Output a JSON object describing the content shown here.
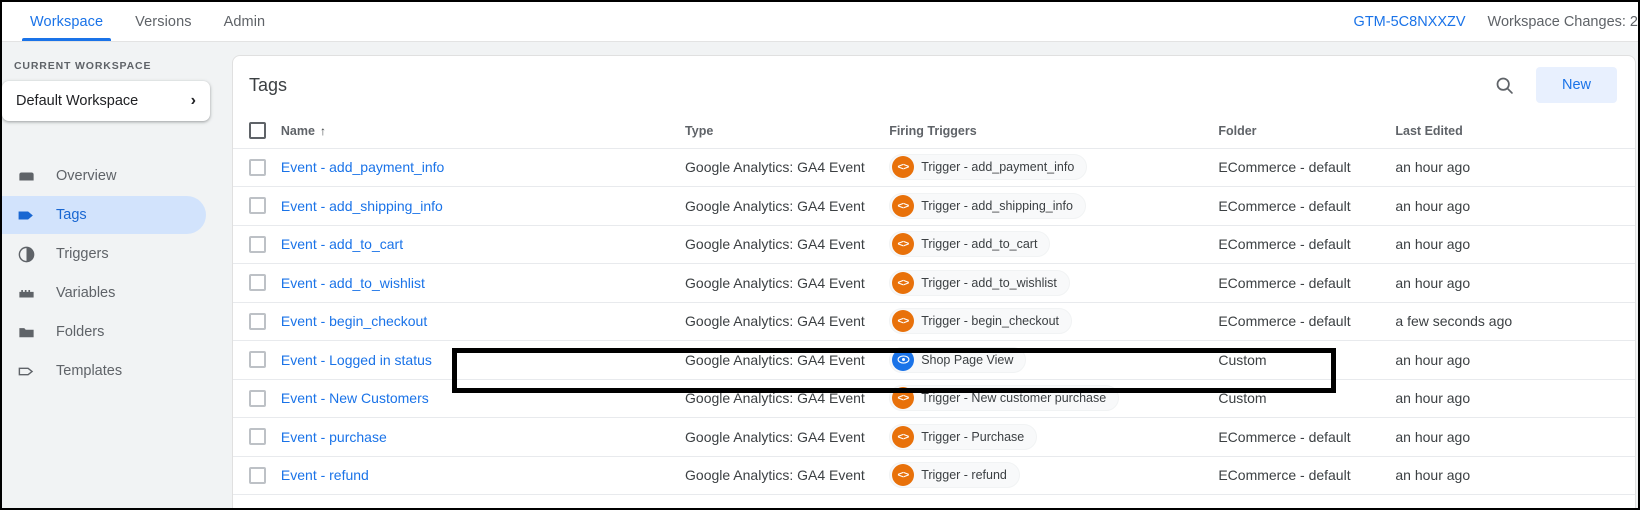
{
  "topnav": {
    "tabs": [
      {
        "label": "Workspace",
        "active": true
      },
      {
        "label": "Versions",
        "active": false
      },
      {
        "label": "Admin",
        "active": false
      }
    ],
    "container_id": "GTM-5C8NXXZV",
    "workspace_changes": "Workspace Changes: 2"
  },
  "sidebar": {
    "section_label": "CURRENT WORKSPACE",
    "workspace_name": "Default Workspace",
    "chevron": "›",
    "items": [
      {
        "label": "Overview",
        "icon": "overview-icon",
        "selected": false
      },
      {
        "label": "Tags",
        "icon": "tag-icon",
        "selected": true
      },
      {
        "label": "Triggers",
        "icon": "trigger-icon",
        "selected": false
      },
      {
        "label": "Variables",
        "icon": "variable-icon",
        "selected": false
      },
      {
        "label": "Folders",
        "icon": "folder-icon",
        "selected": false
      },
      {
        "label": "Templates",
        "icon": "template-icon",
        "selected": false
      }
    ]
  },
  "card": {
    "title": "Tags",
    "search_icon": "search-icon",
    "new_label": "New"
  },
  "table": {
    "columns": [
      "Name",
      "Type",
      "Firing Triggers",
      "Folder",
      "Last Edited"
    ],
    "sort_column": "Name",
    "sort_arrow": "↑",
    "rows": [
      {
        "name": "Event - add_payment_info",
        "type": "Google Analytics: GA4 Event",
        "trigger": "Trigger - add_payment_info",
        "trigger_icon": "code-trigger-icon",
        "trigger_icon_color": "#e8710a",
        "folder": "ECommerce - default",
        "last_edited": "an hour ago",
        "highlighted": false
      },
      {
        "name": "Event - add_shipping_info",
        "type": "Google Analytics: GA4 Event",
        "trigger": "Trigger - add_shipping_info",
        "trigger_icon": "code-trigger-icon",
        "trigger_icon_color": "#e8710a",
        "folder": "ECommerce - default",
        "last_edited": "an hour ago",
        "highlighted": false
      },
      {
        "name": "Event - add_to_cart",
        "type": "Google Analytics: GA4 Event",
        "trigger": "Trigger - add_to_cart",
        "trigger_icon": "code-trigger-icon",
        "trigger_icon_color": "#e8710a",
        "folder": "ECommerce - default",
        "last_edited": "an hour ago",
        "highlighted": false
      },
      {
        "name": "Event - add_to_wishlist",
        "type": "Google Analytics: GA4 Event",
        "trigger": "Trigger - add_to_wishlist",
        "trigger_icon": "code-trigger-icon",
        "trigger_icon_color": "#e8710a",
        "folder": "ECommerce - default",
        "last_edited": "an hour ago",
        "highlighted": false
      },
      {
        "name": "Event - begin_checkout",
        "type": "Google Analytics: GA4 Event",
        "trigger": "Trigger - begin_checkout",
        "trigger_icon": "code-trigger-icon",
        "trigger_icon_color": "#e8710a",
        "folder": "ECommerce - default",
        "last_edited": "a few seconds ago",
        "highlighted": true
      },
      {
        "name": "Event - Logged in status",
        "type": "Google Analytics: GA4 Event",
        "trigger": "Shop Page View",
        "trigger_icon": "pageview-trigger-icon",
        "trigger_icon_color": "#1a73e8",
        "folder": "Custom",
        "last_edited": "an hour ago",
        "highlighted": false
      },
      {
        "name": "Event - New Customers",
        "type": "Google Analytics: GA4 Event",
        "trigger": "Trigger - New customer purchase",
        "trigger_icon": "code-trigger-icon",
        "trigger_icon_color": "#e8710a",
        "folder": "Custom",
        "last_edited": "an hour ago",
        "highlighted": false
      },
      {
        "name": "Event - purchase",
        "type": "Google Analytics: GA4 Event",
        "trigger": "Trigger - Purchase",
        "trigger_icon": "code-trigger-icon",
        "trigger_icon_color": "#e8710a",
        "folder": "ECommerce - default",
        "last_edited": "an hour ago",
        "highlighted": false
      },
      {
        "name": "Event - refund",
        "type": "Google Analytics: GA4 Event",
        "trigger": "Trigger - refund",
        "trigger_icon": "code-trigger-icon",
        "trigger_icon_color": "#e8710a",
        "folder": "ECommerce - default",
        "last_edited": "an hour ago",
        "highlighted": false
      }
    ]
  },
  "colors": {
    "accent": "#1a73e8",
    "selected_nav_bg": "#d2e3fc",
    "trigger_orange": "#e8710a",
    "annotation": "#000000"
  }
}
